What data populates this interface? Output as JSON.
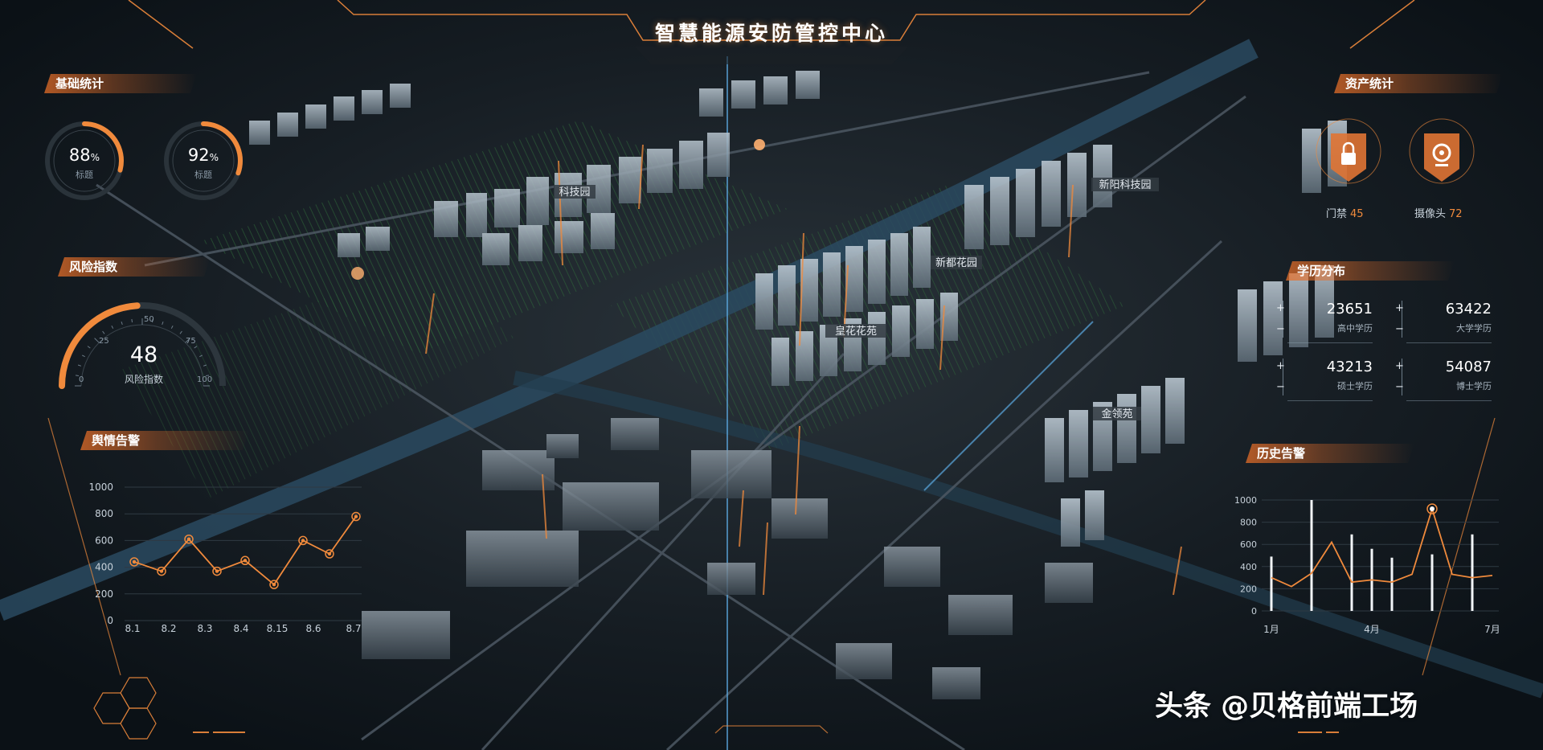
{
  "header": {
    "title": "智慧能源安防管控中心"
  },
  "basic_stats": {
    "title": "基础统计",
    "rings": [
      {
        "value": "88",
        "unit": "%",
        "label": "标题",
        "fraction": 0.88
      },
      {
        "value": "92",
        "unit": "%",
        "label": "标题",
        "fraction": 0.92
      }
    ]
  },
  "risk": {
    "title": "风险指数",
    "value": "48",
    "label": "风险指数",
    "ticks": [
      "0",
      "25",
      "50",
      "75",
      "100"
    ],
    "level": 48
  },
  "sentiment": {
    "title": "舆情告警",
    "y_ticks": [
      "1000",
      "800",
      "600",
      "400",
      "200",
      "0"
    ],
    "x_ticks": [
      "8.1",
      "8.2",
      "8.3",
      "8.4",
      "8.15",
      "8.6",
      "8.7"
    ]
  },
  "assets": {
    "title": "资产统计",
    "items": [
      {
        "label": "门禁",
        "value": "45",
        "icon": "lock-icon"
      },
      {
        "label": "摄像头",
        "value": "72",
        "icon": "camera-icon"
      }
    ]
  },
  "education": {
    "title": "学历分布",
    "items": [
      {
        "value": "23651",
        "label": "高中学历"
      },
      {
        "value": "63422",
        "label": "大学学历"
      },
      {
        "value": "43213",
        "label": "硕士学历"
      },
      {
        "value": "54087",
        "label": "博士学历"
      }
    ]
  },
  "history": {
    "title": "历史告警",
    "y_ticks": [
      "1000",
      "800",
      "600",
      "400",
      "200",
      "0"
    ],
    "x_ticks": [
      "1月",
      "4月",
      "7月"
    ]
  },
  "map_labels": [
    "科技园",
    "皇花花苑",
    "金领苑",
    "新都花园",
    "新阳科技园"
  ],
  "watermark": "头条 @贝格前端工场",
  "colors": {
    "accent": "#f08a3c",
    "background": "#0b1116",
    "river": "#2a4a60"
  },
  "chart_data": [
    {
      "type": "line",
      "x": [
        "8.1",
        "8.2",
        "8.3",
        "8.4",
        "8.45",
        "8.15",
        "8.5",
        "8.55",
        "8.7"
      ],
      "values": [
        440,
        370,
        610,
        370,
        450,
        270,
        600,
        500,
        780
      ],
      "ylim": [
        0,
        1000
      ]
    },
    {
      "type": "bar",
      "series": [
        {
          "type": "bar",
          "values": [
            490,
            230,
            1000,
            360,
            690,
            560,
            480,
            310,
            510,
            380,
            690,
            320
          ]
        },
        {
          "type": "line",
          "values": [
            300,
            220,
            340,
            620,
            260,
            280,
            260,
            330,
            920,
            330,
            300,
            320
          ]
        }
      ],
      "ylim": [
        0,
        1000
      ]
    }
  ]
}
